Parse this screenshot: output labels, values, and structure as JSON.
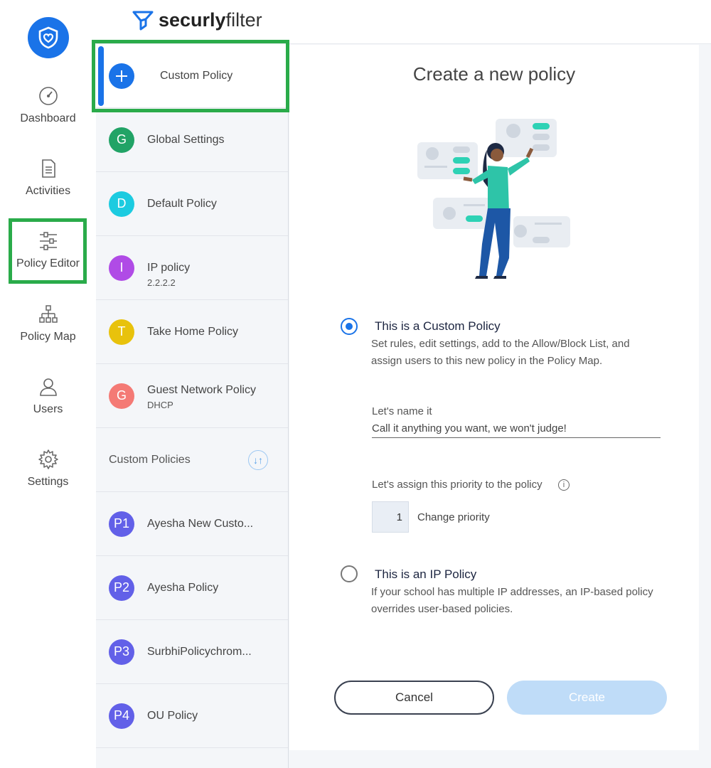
{
  "nav": {
    "items": [
      {
        "label": "Dashboard",
        "icon": "gauge-icon"
      },
      {
        "label": "Activities",
        "icon": "document-icon"
      },
      {
        "label": "Policy Editor",
        "icon": "sliders-icon"
      },
      {
        "label": "Policy Map",
        "icon": "hierarchy-icon"
      },
      {
        "label": "Users",
        "icon": "user-icon"
      },
      {
        "label": "Settings",
        "icon": "gear-icon"
      }
    ],
    "active": "Policy Editor"
  },
  "header": {
    "brand_bold": "securly",
    "brand_light": "filter"
  },
  "policies": {
    "custom": {
      "label": "Custom Policy",
      "icon": "plus-icon"
    },
    "items": [
      {
        "initial": "G",
        "name": "Global Settings",
        "sub": "",
        "color": "#21a366"
      },
      {
        "initial": "D",
        "name": "Default Policy",
        "sub": "",
        "color": "#1ccbe0"
      },
      {
        "initial": "I",
        "name": "IP policy",
        "sub": "2.2.2.2",
        "color": "#b04be6"
      },
      {
        "initial": "T",
        "name": "Take Home Policy",
        "sub": "",
        "color": "#e8c20c"
      },
      {
        "initial": "G",
        "name": "Guest Network Policy",
        "sub": "DHCP",
        "color": "#f47a75"
      }
    ],
    "section_title": "Custom Policies",
    "custom_items": [
      {
        "initial": "P1",
        "name": "Ayesha New Custo...",
        "color": "#6260e8"
      },
      {
        "initial": "P2",
        "name": "Ayesha Policy",
        "color": "#6260e8"
      },
      {
        "initial": "P3",
        "name": "SurbhiPolicychrom...",
        "color": "#6260e8"
      },
      {
        "initial": "P4",
        "name": "OU Policy",
        "color": "#6260e8"
      }
    ]
  },
  "form": {
    "title": "Create a new policy",
    "option_custom": {
      "title": "This is a Custom Policy",
      "desc": "Set rules, edit settings, add to the Allow/Block List, and assign users to this new policy in the Policy Map.",
      "selected": true
    },
    "name_label": "Let's name it",
    "name_placeholder": "Call it anything you want, we won't judge!",
    "priority_label": "Let's assign this priority to the policy",
    "priority_value": "1",
    "change_priority": "Change priority",
    "option_ip": {
      "title": "This is an IP Policy",
      "desc": "If your school has multiple IP addresses, an IP-based policy overrides user-based policies.",
      "selected": false
    },
    "cancel_label": "Cancel",
    "create_label": "Create"
  },
  "colors": {
    "accent": "#1a73e8",
    "highlight": "#2aab4a",
    "create_disabled": "#bfdcf8"
  }
}
